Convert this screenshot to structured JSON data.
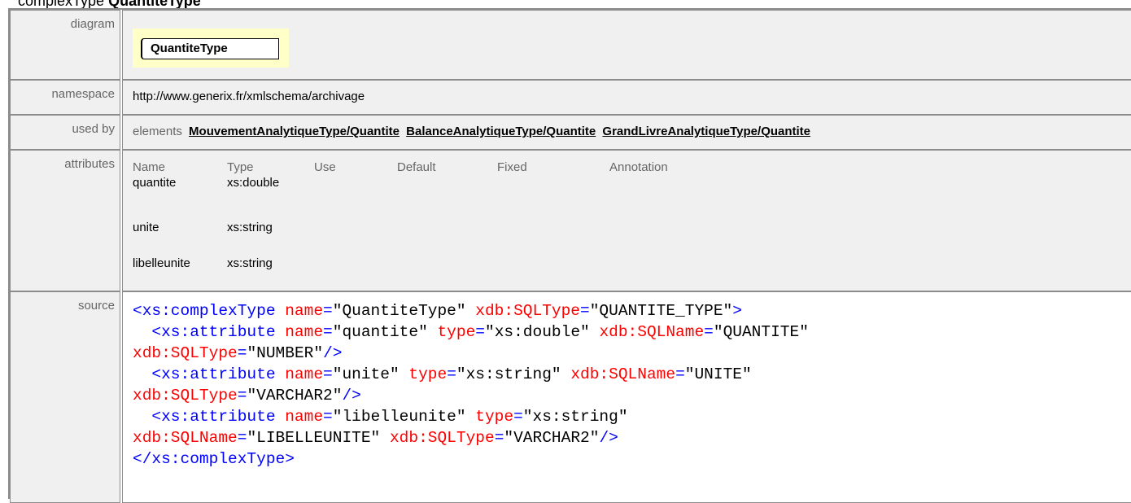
{
  "page": {
    "prefix": "complexType",
    "name": "QuantiteType"
  },
  "labels": {
    "diagram": "diagram",
    "namespace": "namespace",
    "used_by": "used by",
    "attributes": "attributes",
    "source": "source"
  },
  "diagram": {
    "node_label": "QuantiteType",
    "background": "#ffffc8"
  },
  "namespace": "http://www.generix.fr/xmlschema/archivage",
  "used_by": {
    "prefix": "elements",
    "links": [
      "MouvementAnalytiqueType/Quantite",
      "BalanceAnalytiqueType/Quantite",
      "GrandLivreAnalytiqueType/Quantite"
    ]
  },
  "attributes": {
    "headers": [
      "Name",
      "Type",
      "Use",
      "Default",
      "Fixed",
      "Annotation"
    ],
    "rows": [
      {
        "name": "quantite",
        "type": "xs:double"
      },
      {
        "name": "unite",
        "type": "xs:string"
      },
      {
        "name": "libelleunite",
        "type": "xs:string"
      }
    ]
  },
  "source": {
    "colors": {
      "tag": "#0000ff",
      "attribute": "#ff0000",
      "value": "#000000"
    },
    "l1_open": "<xs:complexType",
    "l1_a1": "name",
    "l1_v1": "\"QuantiteType\"",
    "l1_a2": "xdb:SQLType",
    "l1_v2": "\"QUANTITE_TYPE\"",
    "l1_close": ">",
    "l2_open": "<xs:attribute",
    "l2_a1": "name",
    "l2_v1": "\"quantite\"",
    "l2_a2": "type",
    "l2_v2": "\"xs:double\"",
    "l2_a3": "xdb:SQLName",
    "l2_v3": "\"QUANTITE\"",
    "l3_a1": "xdb:SQLType",
    "l3_v1": "\"NUMBER\"",
    "l3_close": "/>",
    "l4_open": "<xs:attribute",
    "l4_a1": "name",
    "l4_v1": "\"unite\"",
    "l4_a2": "type",
    "l4_v2": "\"xs:string\"",
    "l4_a3": "xdb:SQLName",
    "l4_v3": "\"UNITE\"",
    "l5_a1": "xdb:SQLType",
    "l5_v1": "\"VARCHAR2\"",
    "l5_close": "/>",
    "l6_open": "<xs:attribute",
    "l6_a1": "name",
    "l6_v1": "\"libelleunite\"",
    "l6_a2": "type",
    "l6_v2": "\"xs:string\"",
    "l7_a1": "xdb:SQLName",
    "l7_v1": "\"LIBELLEUNITE\"",
    "l7_a2": "xdb:SQLType",
    "l7_v2": "\"VARCHAR2\"",
    "l7_close": "/>",
    "l8_close": "</xs:complexType>",
    "eq": "="
  }
}
